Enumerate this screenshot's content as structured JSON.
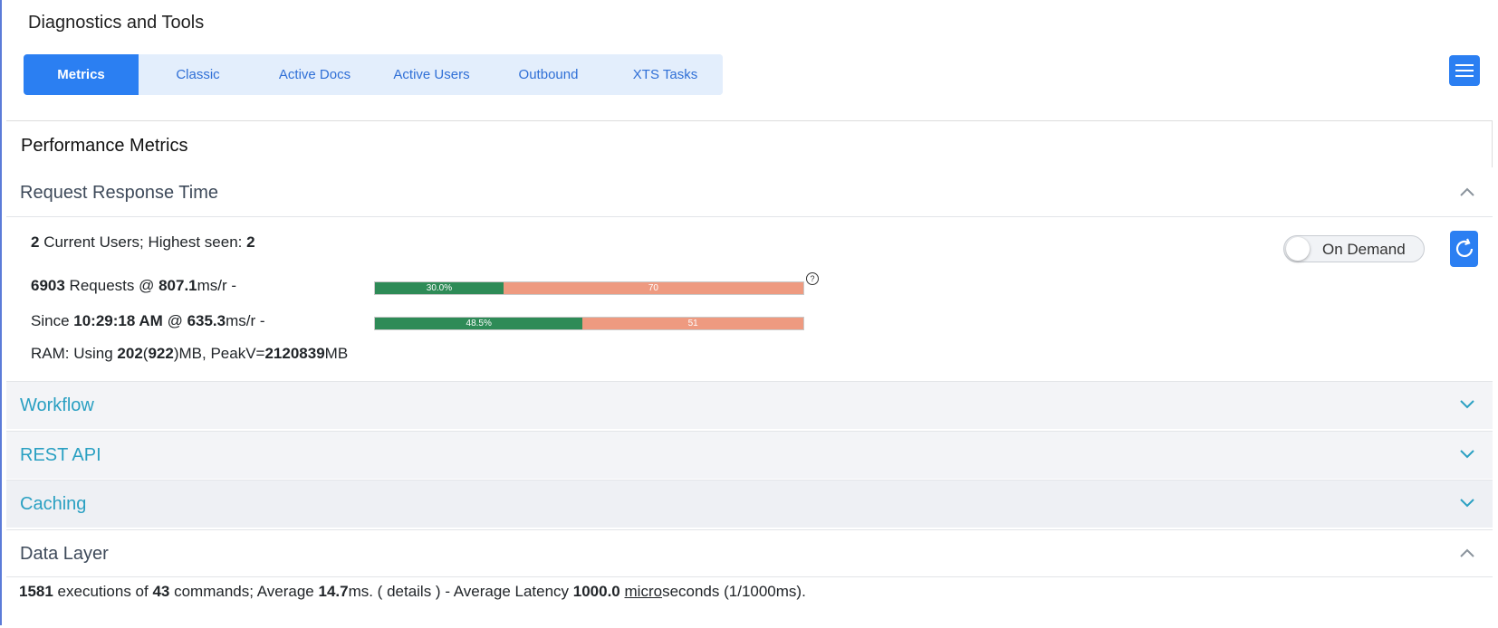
{
  "app": {
    "title": "Diagnostics and Tools"
  },
  "tabs": [
    {
      "label": "Metrics",
      "active": true
    },
    {
      "label": "Classic",
      "active": false
    },
    {
      "label": "Active Docs",
      "active": false
    },
    {
      "label": "Active Users",
      "active": false
    },
    {
      "label": "Outbound",
      "active": false
    },
    {
      "label": "XTS Tasks",
      "active": false
    }
  ],
  "menu": {
    "icon": "hamburger-icon"
  },
  "panel": {
    "title": "Performance Metrics"
  },
  "sections": {
    "request_response_time": {
      "label": "Request Response Time",
      "expanded": true
    },
    "workflow": {
      "label": "Workflow",
      "expanded": false
    },
    "rest_api": {
      "label": "REST API",
      "expanded": false
    },
    "caching": {
      "label": "Caching",
      "expanded": false
    },
    "data_layer": {
      "label": "Data Layer",
      "expanded": true
    }
  },
  "rrt": {
    "users": {
      "current": "2",
      "text1": " Current Users; Highest seen: ",
      "highest": "2"
    },
    "requests": {
      "count": "6903",
      "text1": " Requests @ ",
      "ms": "807.1",
      "text2": "ms/r -"
    },
    "since": {
      "prefix": "Since ",
      "time": "10:29:18 AM",
      "text1": " @ ",
      "ms": "635.3",
      "text2": "ms/r -"
    },
    "ram": {
      "prefix": "RAM: Using ",
      "using": "202",
      "paren_open": "(",
      "total": "922",
      "paren_close": ")MB, PeakV=",
      "peak": "2120839",
      "suffix": "MB"
    },
    "bar1": {
      "good_pct": 30.0,
      "good_label": "30.0%",
      "bad_label": "70"
    },
    "bar2": {
      "good_pct": 48.5,
      "good_label": "48.5%",
      "bad_label": "51"
    },
    "help_glyph": "?",
    "toggle": {
      "label": "On Demand",
      "on": false
    }
  },
  "data_layer": {
    "executions": "1581",
    "t1": " executions of ",
    "commands": "43",
    "t2": " commands; Average ",
    "avg": "14.7",
    "t3": "ms. ( details ) - Average Latency ",
    "latency": "1000.0",
    "t4": " ",
    "micro": "micro",
    "t5": "seconds (1/1000ms)."
  },
  "colors": {
    "accent": "#2b7ff2",
    "good": "#2e8b57",
    "bad": "#ee9a80",
    "section_link": "#2aa0c2"
  }
}
